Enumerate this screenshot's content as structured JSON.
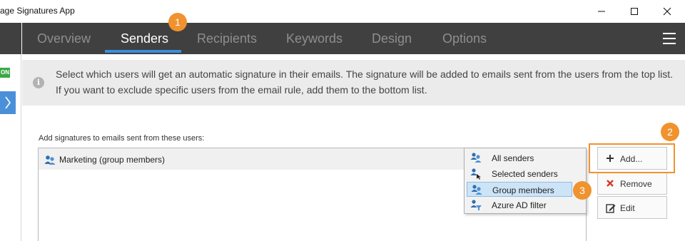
{
  "window": {
    "title": "age Signatures App",
    "minimize_icon": "minimize-icon",
    "maximize_icon": "maximize-icon",
    "close_icon": "close-icon"
  },
  "sidebar": {
    "status_badge": "ON",
    "expand_icon": "chevron-right-icon",
    "accent": "#4a90d9"
  },
  "nav": {
    "tabs": [
      {
        "label": "Overview",
        "active": false
      },
      {
        "label": "Senders",
        "active": true
      },
      {
        "label": "Recipients",
        "active": false
      },
      {
        "label": "Keywords",
        "active": false
      },
      {
        "label": "Design",
        "active": false
      },
      {
        "label": "Options",
        "active": false
      }
    ],
    "menu_icon": "hamburger-menu-icon",
    "background": "#404040",
    "active_underline": "#3a8fdc"
  },
  "info": {
    "icon": "info-icon",
    "line1": "Select which users will get an automatic signature in their emails. The signature will be added to emails sent from the users from the top list.",
    "line2": "If you want to exclude specific users from the email rule, add them to the bottom list."
  },
  "senders": {
    "section_label": "Add signatures to emails sent from these users:",
    "rows": [
      {
        "icon": "group-users-icon",
        "label": "Marketing (group members)"
      }
    ]
  },
  "buttons": {
    "add": {
      "label": "Add...",
      "icon": "plus-icon"
    },
    "remove": {
      "label": "Remove",
      "icon": "red-x-icon"
    },
    "edit": {
      "label": "Edit",
      "icon": "edit-icon"
    }
  },
  "add_menu": {
    "items": [
      {
        "label": "All senders",
        "icon": "all-senders-icon",
        "highlighted": false
      },
      {
        "label": "Selected senders",
        "icon": "selected-senders-icon",
        "highlighted": false
      },
      {
        "label": "Group members",
        "icon": "group-members-icon",
        "highlighted": true
      },
      {
        "label": "Azure AD filter",
        "icon": "azure-ad-filter-icon",
        "highlighted": false
      }
    ]
  },
  "callouts": {
    "step1": "1",
    "step2": "2",
    "step3": "3",
    "color": "#f0922d"
  }
}
